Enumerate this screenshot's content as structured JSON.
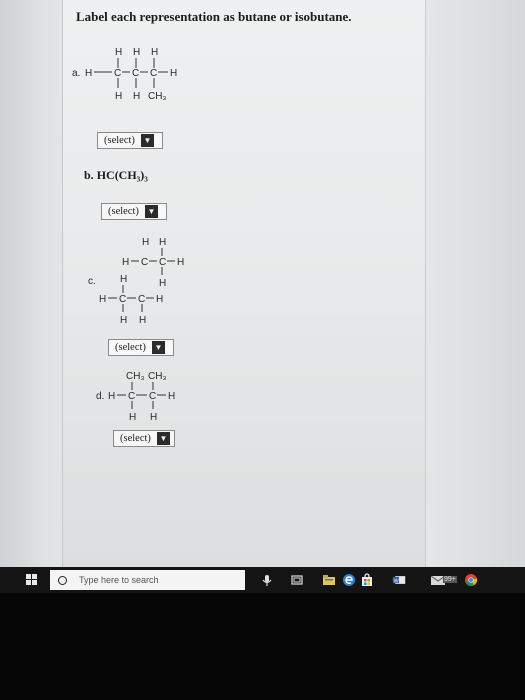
{
  "question": {
    "title": "Label each representation as butane or isobutane."
  },
  "items": [
    {
      "label": "a.",
      "structure": {
        "top": [
          "H",
          "H",
          "H"
        ],
        "chain": [
          "H",
          "C",
          "C",
          "C",
          "H"
        ],
        "bottom": [
          "H",
          "H",
          "CH₃"
        ]
      },
      "select": "(select)"
    },
    {
      "label": "b.",
      "formula": "HC(CH₃)₃",
      "select": "(select)"
    },
    {
      "label": "c.",
      "structure": {
        "r1": [
          "H",
          "H"
        ],
        "r2": [
          "H",
          "C",
          "C",
          "H"
        ],
        "r3": [
          "H",
          "H"
        ],
        "r4": [
          "H",
          "C",
          "C",
          "H"
        ],
        "r5": [
          "H",
          "H"
        ]
      },
      "select": "(select)"
    },
    {
      "label": "d.",
      "structure": {
        "top": [
          "CH₃",
          "CH₃"
        ],
        "chain": [
          "H",
          "C",
          "C",
          "H"
        ],
        "bottom": [
          "H",
          "H"
        ]
      },
      "select": "(select)"
    }
  ],
  "taskbar": {
    "search_placeholder": "Type here to search",
    "badge": "99+"
  },
  "icons": {
    "arrow": "▼"
  }
}
